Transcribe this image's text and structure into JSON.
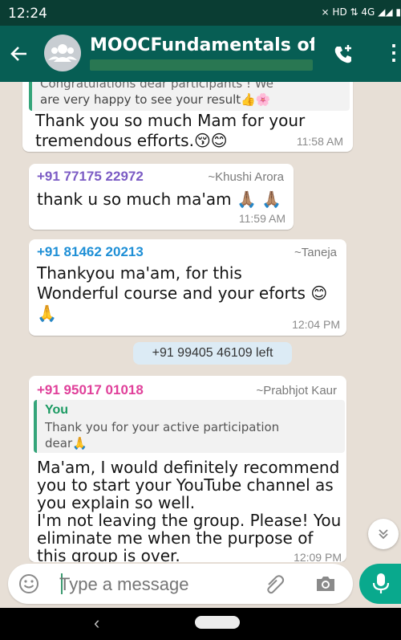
{
  "status_bar": {
    "time": "12:24",
    "icons": "⨯ HD ⇅ 4G ◢◢ ▮"
  },
  "header": {
    "back_icon": "arrow-left-icon",
    "title": "MOOCFundamentals of...",
    "call_icon": "add-call-icon",
    "menu_icon": "more-vertical-icon",
    "accent": "#075e54"
  },
  "messages": [
    {
      "quote": "Congratulations dear participants ! We are very happy to see your result👍🌸",
      "quote_line1": "Congratulations dear participants ! We",
      "quote_line2": "are very happy to see your result👍🌸",
      "line1": "Thank you so much Mam for your",
      "line2": "tremendous efforts.😚😊",
      "time": "11:58 AM"
    },
    {
      "sender": "+91 77175 22972",
      "name": "~Khushi Arora",
      "sender_color": "#7b5bc4",
      "text": "thank u so much ma'am 🙏🏽 🙏🏽",
      "time": "11:59 AM"
    },
    {
      "sender": "+91 81462 20213",
      "name": "~Taneja",
      "sender_color": "#1e8fd6",
      "line1": "Thankyou ma'am, for this",
      "line2": "Wonderful course and  your eforts 😊",
      "line3": "🙏",
      "time": "12:04 PM"
    },
    {
      "sender": "+91 95017 01018",
      "name": "~Prabhjot Kaur",
      "sender_color": "#e0409a",
      "quote_author": "You",
      "quote_line1": "Thank you for your active participation",
      "quote_line2": "dear🙏",
      "lines": [
        "Ma'am, I would definitely recommend",
        "you to start your YouTube channel as",
        "you explain so well.",
        "I'm not leaving the group. Please! You",
        "eliminate me when the purpose of",
        "this group is over."
      ],
      "time": "12:09 PM"
    }
  ],
  "system_note": "+91 99405 46109 left",
  "scroll_icon": "double-chevron-down-icon",
  "input": {
    "placeholder": "Type a message",
    "emoji_icon": "emoji-icon",
    "attach_icon": "paperclip-icon",
    "camera_icon": "camera-icon",
    "mic_icon": "microphone-icon"
  },
  "nav": {
    "back": "‹"
  }
}
